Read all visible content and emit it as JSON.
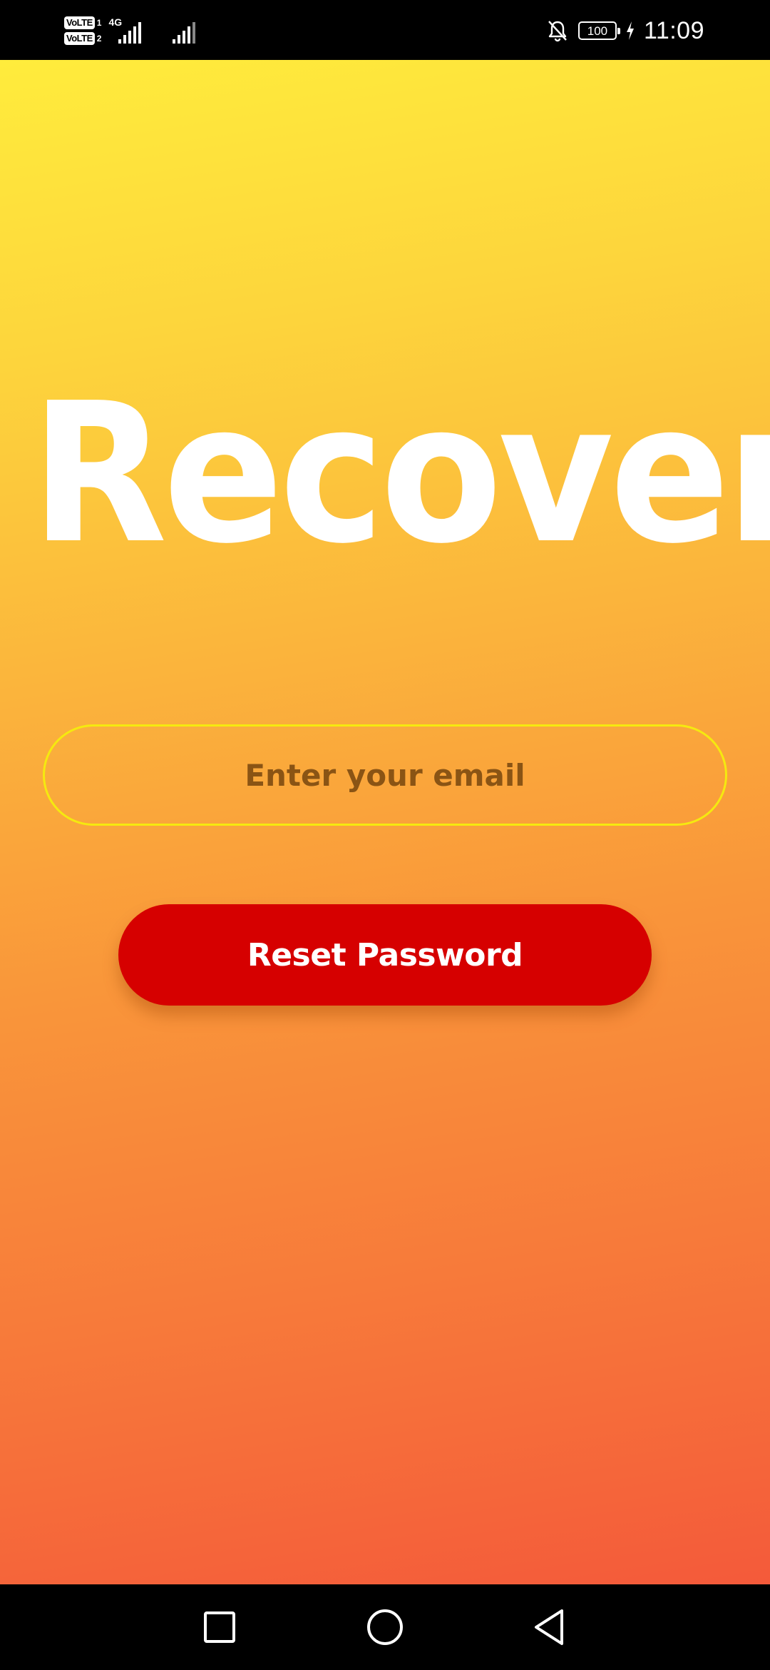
{
  "status_bar": {
    "sim1_label": "VoLTE",
    "sim1_slot": "1",
    "sim2_label": "VoLTE",
    "sim2_slot": "2",
    "network_type": "4G",
    "battery_level": "100",
    "time": "11:09",
    "icons": [
      "volte-icon",
      "signal-strength-icon",
      "mute-notifications-icon",
      "battery-icon",
      "charging-bolt-icon"
    ]
  },
  "screen": {
    "title": "Recover",
    "email_placeholder": "Enter your email",
    "email_value": "",
    "reset_button_label": "Reset Password"
  },
  "nav_bar": {
    "icons": [
      "recents-square-icon",
      "home-circle-icon",
      "back-triangle-icon"
    ]
  },
  "colors": {
    "gradient_top": "#ffec3c",
    "gradient_bottom": "#f45a3a",
    "title_text": "#ffffff",
    "email_border": "#f5e90f",
    "email_placeholder": "#8a5414",
    "button_background": "#d60000",
    "button_text": "#ffffff",
    "system_bars": "#000000"
  }
}
